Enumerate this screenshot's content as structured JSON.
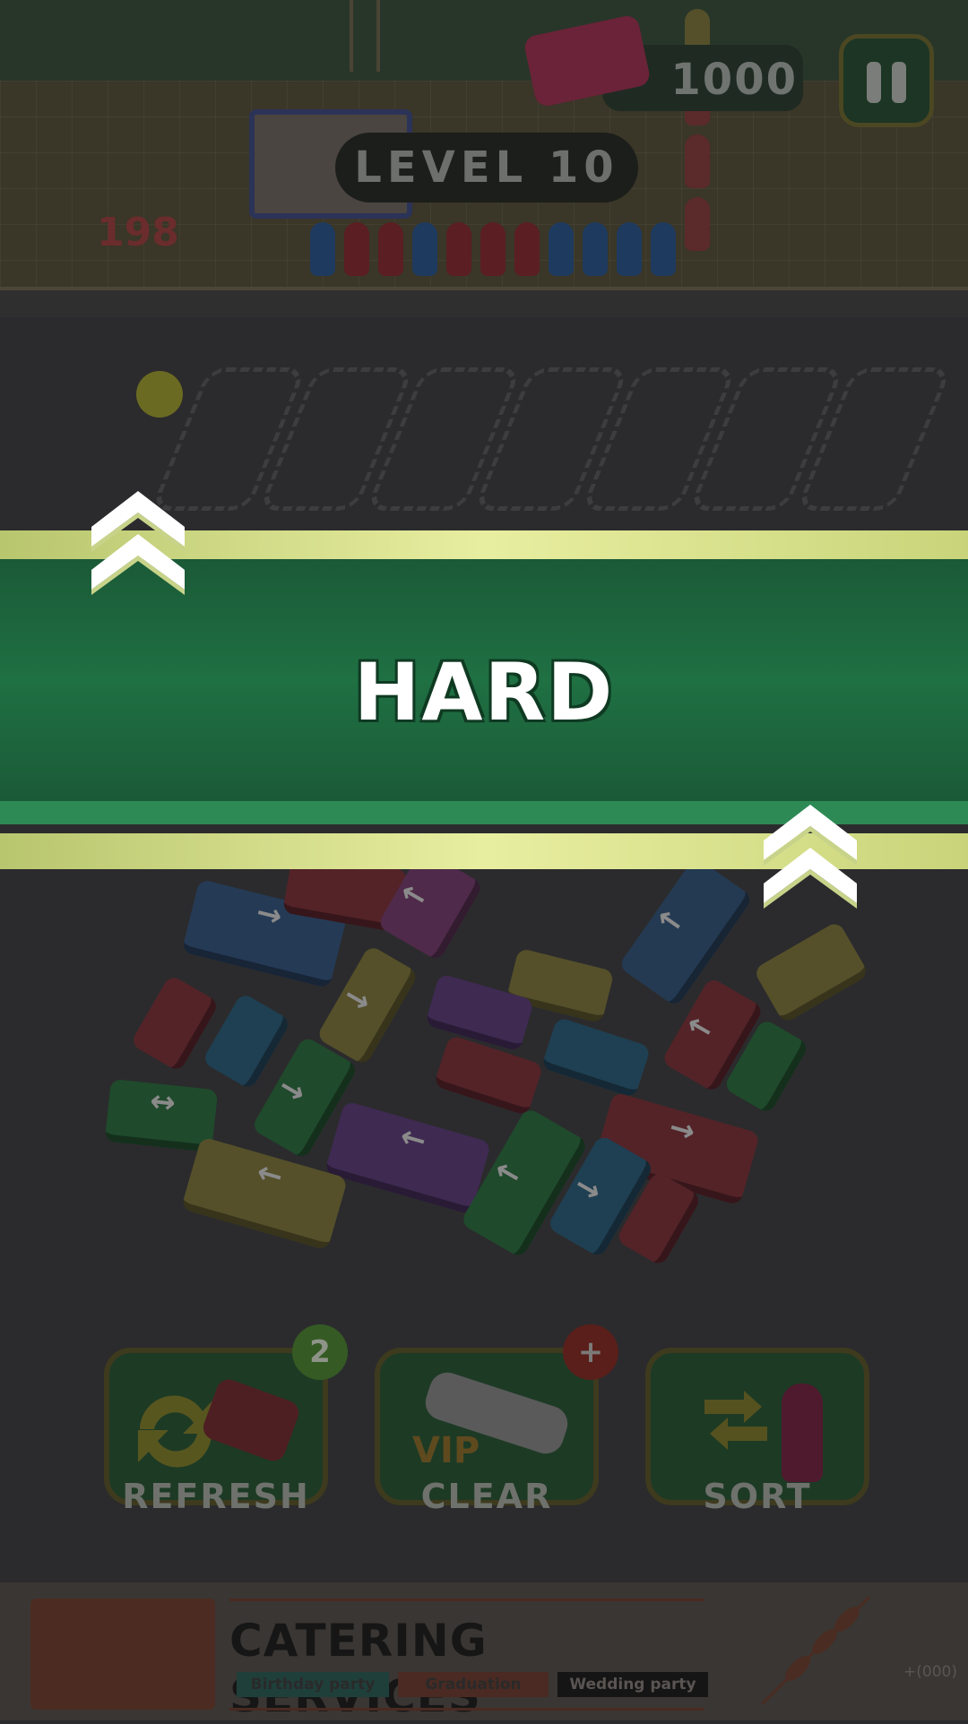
{
  "hud": {
    "coins": "1000",
    "level": "LEVEL 10",
    "queue_count": "198"
  },
  "banner": {
    "difficulty": "HARD"
  },
  "boosters": [
    {
      "label": "REFRESH",
      "badge": "2"
    },
    {
      "label": "CLEAR",
      "badge": "+",
      "vip": "VIP"
    },
    {
      "label": "SORT"
    }
  ],
  "ad": {
    "title": "CATERING SERVICES",
    "tags": [
      "Birthday party",
      "Graduation",
      "Wedding party"
    ],
    "phone": "+(000)"
  },
  "colors": {
    "banner_green": "#1f7043",
    "banner_glow": "#e8eea0",
    "overlay": "#2b2b2d"
  }
}
